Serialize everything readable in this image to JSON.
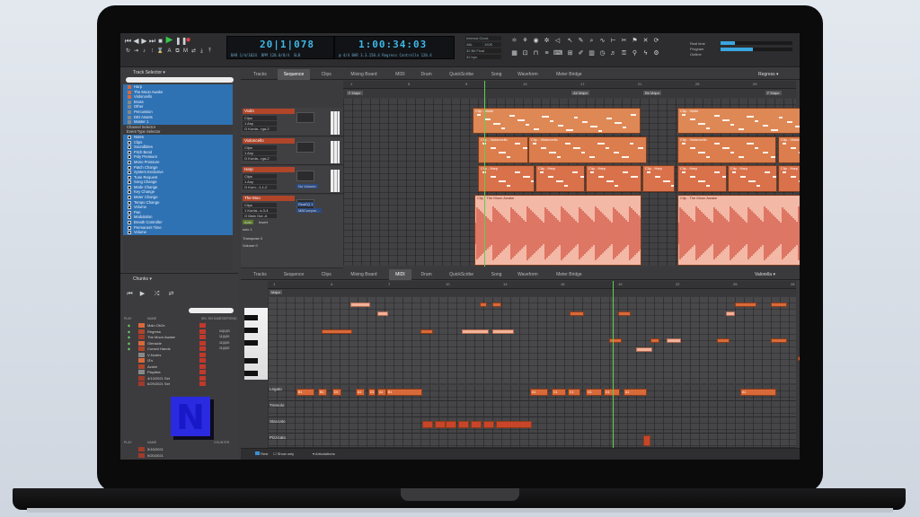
{
  "transport": {
    "bars_beats": "20|1|078",
    "time": "1:00:34:03",
    "sub_left": [
      "BAR 1/4/1024",
      "BPM 120.0/8/4",
      "SLB"
    ],
    "sub_right": [
      "@ 4/4 BAR",
      "3.3.150.4",
      "Regress",
      "Controllo",
      "120.4"
    ],
    "clock": [
      "Internal Clock",
      "48k",
      "192K",
      "32 Bit Float",
      "32 bps"
    ],
    "right_info": [
      "Real time",
      "Program",
      "Outline"
    ]
  },
  "top_tabs": [
    "Tracks",
    "Sequence",
    "Clips",
    "Mixing Board",
    "MIDI",
    "Drum",
    "QuickScribe",
    "Song",
    "Waveform",
    "Meter Bridge"
  ],
  "top_tabs_active": 1,
  "top_right_select": "Regress",
  "bottom_tabs_active": 4,
  "bottom_right_select": "Valorella",
  "track_selector": {
    "title": "Track Selector",
    "items": [
      {
        "label": "Harp",
        "color": "#d8683a",
        "sel": true
      },
      {
        "label": "The Moon Awake",
        "color": "#d8683a",
        "sel": true
      },
      {
        "label": "Violoncello",
        "color": "#d8683a",
        "sel": true
      },
      {
        "label": "Brass",
        "color": "#888888",
        "sel": true
      },
      {
        "label": "Other",
        "color": "#888888",
        "sel": true
      },
      {
        "label": "Percussion",
        "color": "#888888",
        "sel": true
      },
      {
        "label": "DID Assets",
        "color": "#888888",
        "sel": true
      },
      {
        "label": "Master 1",
        "color": "#888888",
        "sel": true
      }
    ],
    "channel_header": "Channel Selector",
    "event_header": "Event Type Selector",
    "events": [
      "Notes",
      "Clips",
      "Soundbites",
      "Pitch Bend",
      "Poly Pressure",
      "Mono Pressure",
      "Patch Change",
      "System Exclusive",
      "Tune Request",
      "Song Change",
      "Mode Change",
      "Key Change",
      "Meter Change",
      "Tempo Change",
      "Volume",
      "Pan",
      "Modulation",
      "Breath Controller",
      "Permanent Time",
      "Volume"
    ]
  },
  "chunks": {
    "title": "Chunks",
    "columns": [
      "PLAY",
      "NAME",
      "SEL",
      "EN",
      "SAC",
      "START/END"
    ],
    "rows": [
      {
        "name": "Main Ob2e",
        "time": ""
      },
      {
        "name": "Regress",
        "time": "04|1|00"
      },
      {
        "name": "The Moon Awake",
        "time": "11|1|00"
      },
      {
        "name": "Glenside",
        "time": "11|1|00"
      },
      {
        "name": "Cursed Hands",
        "time": "11|1|00"
      },
      {
        "name": "V-Nodes",
        "time": ""
      },
      {
        "name": "I3's",
        "time": ""
      },
      {
        "name": "Avalni",
        "time": ""
      },
      {
        "name": "Playlists",
        "time": ""
      },
      {
        "name": "4/13/2021 Set",
        "time": ""
      },
      {
        "name": "6/29/2021 Set",
        "time": ""
      }
    ],
    "lower_columns": [
      "PLAY",
      "NAME",
      "COUNTER"
    ],
    "lower_rows": [
      "5/15/2021",
      "9/20/2021"
    ]
  },
  "tracks": [
    {
      "name": "Violin",
      "f1": "Clips",
      "f2": "1 Any",
      "f3": "O Korda...rga-2"
    },
    {
      "name": "Violoncello",
      "f1": "Clips",
      "f2": "1 Any",
      "f3": "O Korda...rga-2"
    },
    {
      "name": "Harp",
      "f1": "Clips",
      "f2": "1 Any",
      "f3": "O Korn...1-1-2"
    },
    {
      "name": "The Moo",
      "f1": "Clips",
      "f2": "1 Korda...s-3-4",
      "f3": "O Main Out..A"
    }
  ],
  "track_extra": {
    "auto": "Auto",
    "insert": "Insert",
    "solo": "solo 1",
    "transpose_label": "Transpose",
    "transpose_val": "0",
    "volume_label": "Volume",
    "volume_val": "0",
    "vol_box": "No Volume",
    "plug1": "ReaEQ 1",
    "plug2": "MBCompre..."
  },
  "seq_ruler": [
    "1",
    "5",
    "9",
    "13",
    "17",
    "21",
    "25",
    "29"
  ],
  "markers": [
    "F Major",
    "Ab Major",
    "Bb Major",
    "F Major"
  ],
  "clips": {
    "violin": [
      "Clip - Violin",
      "Clip - Violin"
    ],
    "cello": [
      "Clip - Violoncello",
      "Clip - Violoncello",
      "Clip - Violoncello",
      "Clip - Violoncello"
    ],
    "harp": [
      "Clip - Harp",
      "Clip - Harp",
      "Clip - Harp",
      "Clip - Harp",
      "Clip - Harp",
      "Clip - Harp",
      "Clip - Harp",
      "Clip - Harp"
    ],
    "moon": [
      "Clip - The Moon Awake",
      "Clip - The Moon Awake"
    ]
  },
  "midi_ruler": [
    "1",
    "4",
    "7",
    "10",
    "13",
    "16",
    "19",
    "22",
    "25",
    "28"
  ],
  "midi_marker": "Major",
  "lanes": [
    "Legato",
    "Tremolo",
    "Staccato",
    "Pizzicato"
  ],
  "legato_notes": [
    "B1",
    "B1",
    "D1",
    "A1",
    "D1",
    "A1",
    "B1",
    "A1",
    "C1",
    "C1",
    "G1",
    "D1",
    "A1",
    "A1"
  ],
  "bottom_bar": [
    "Rest",
    "Show only",
    "Articulations"
  ],
  "logo_letter": "N"
}
